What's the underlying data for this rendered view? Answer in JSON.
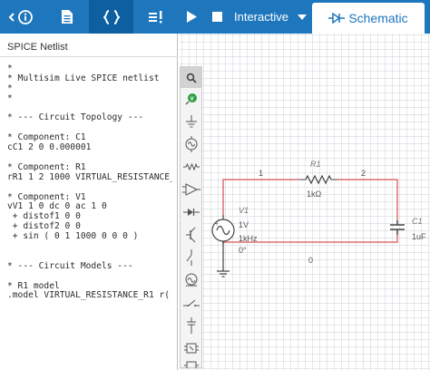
{
  "left_tabs": [
    {
      "icon": "info-icon"
    },
    {
      "icon": "document-icon"
    },
    {
      "icon": "code-braces-icon",
      "active": true
    },
    {
      "icon": "alert-list-icon"
    }
  ],
  "netlist": {
    "title": "SPICE Netlist",
    "lines": [
      "*",
      "* Multisim Live SPICE netlist",
      "*",
      "*",
      "",
      "* --- Circuit Topology ---",
      "",
      "* Component: C1",
      "cC1 2 0 0.000001",
      "",
      "* Component: R1",
      "rR1 1 2 1000 VIRTUAL_RESISTANCE_",
      "",
      "* Component: V1",
      "vV1 1 0 dc 0 ac 1 0",
      " + distof1 0 0",
      " + distof2 0 0",
      " + sin ( 0 1 1000 0 0 0 )",
      "",
      "",
      "* --- Circuit Models ---",
      "",
      "* R1 model",
      ".model VIRTUAL_RESISTANCE_R1 r("
    ]
  },
  "toolbar_top": {
    "mode_label": "Interactive",
    "schematic_tab_label": "Schematic"
  },
  "components_toolbar": [
    "search-icon",
    "probe-icon",
    "ground-icon",
    "ac-source-icon",
    "resistor-icon",
    "opamp-icon",
    "diode-icon",
    "transistor-icon",
    "switch-icon",
    "meter-icon",
    "switch-toggle-icon",
    "power-supply-icon",
    "chip-icon",
    "chip-alt-icon"
  ],
  "schematic": {
    "r1": {
      "name": "R1",
      "value": "1kΩ"
    },
    "c1": {
      "name": "C1",
      "value": "1uF"
    },
    "v1": {
      "name": "V1",
      "amplitude": "1V",
      "frequency": "1kHz",
      "phase": "0°"
    },
    "nodes": {
      "n1": "1",
      "n2": "2",
      "n0": "0"
    }
  },
  "colors": {
    "accent": "#1e77bd",
    "wire": "#e07070",
    "probe": "#2ea043"
  }
}
